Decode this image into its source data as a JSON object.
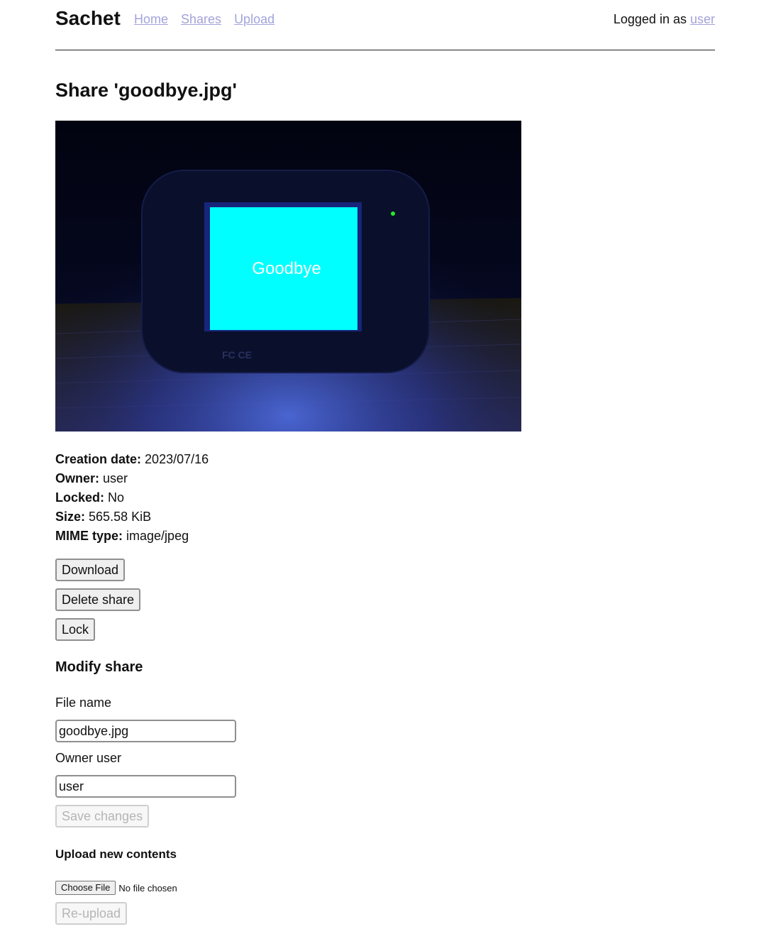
{
  "header": {
    "brand": "Sachet",
    "nav": [
      "Home",
      "Shares",
      "Upload"
    ],
    "login_prefix": "Logged in as",
    "login_user": "user"
  },
  "page_title": "Share 'goodbye.jpg'",
  "preview": {
    "screen_text": "Goodbye",
    "colors": {
      "screen": "#00ffff",
      "background": "#05081f"
    }
  },
  "details": {
    "creation_label": "Creation date:",
    "creation_value": "2023/07/16",
    "owner_label": "Owner:",
    "owner_value": "user",
    "locked_label": "Locked:",
    "locked_value": "No",
    "size_label": "Size:",
    "size_value": "565.58 KiB",
    "mime_label": "MIME type:",
    "mime_value": "image/jpeg"
  },
  "actions": {
    "download": "Download",
    "delete": "Delete share",
    "lock": "Lock"
  },
  "modify": {
    "heading": "Modify share",
    "file_name_label": "File name",
    "file_name_value": "goodbye.jpg",
    "owner_label": "Owner user",
    "owner_value": "user",
    "save_label": "Save changes"
  },
  "upload": {
    "heading": "Upload new contents",
    "choose_label": "Choose File",
    "status": "No file chosen",
    "reupload_label": "Re-upload"
  },
  "colors": {
    "link": "#a3a3dc",
    "disabled_text": "#b5b5b5"
  }
}
